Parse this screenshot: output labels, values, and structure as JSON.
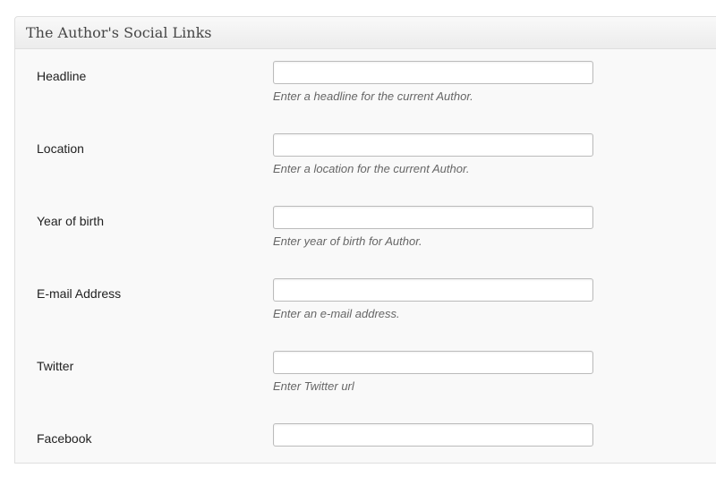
{
  "panel": {
    "title": "The Author's Social Links"
  },
  "fields": [
    {
      "label": "Headline",
      "value": "",
      "description": "Enter a headline for the current Author."
    },
    {
      "label": "Location",
      "value": "",
      "description": "Enter a location for the current Author."
    },
    {
      "label": "Year of birth",
      "value": "",
      "description": "Enter year of birth for Author."
    },
    {
      "label": "E-mail Address",
      "value": "",
      "description": "Enter an e-mail address."
    },
    {
      "label": "Twitter",
      "value": "",
      "description": "Enter Twitter url"
    },
    {
      "label": "Facebook",
      "value": "",
      "description": ""
    }
  ]
}
